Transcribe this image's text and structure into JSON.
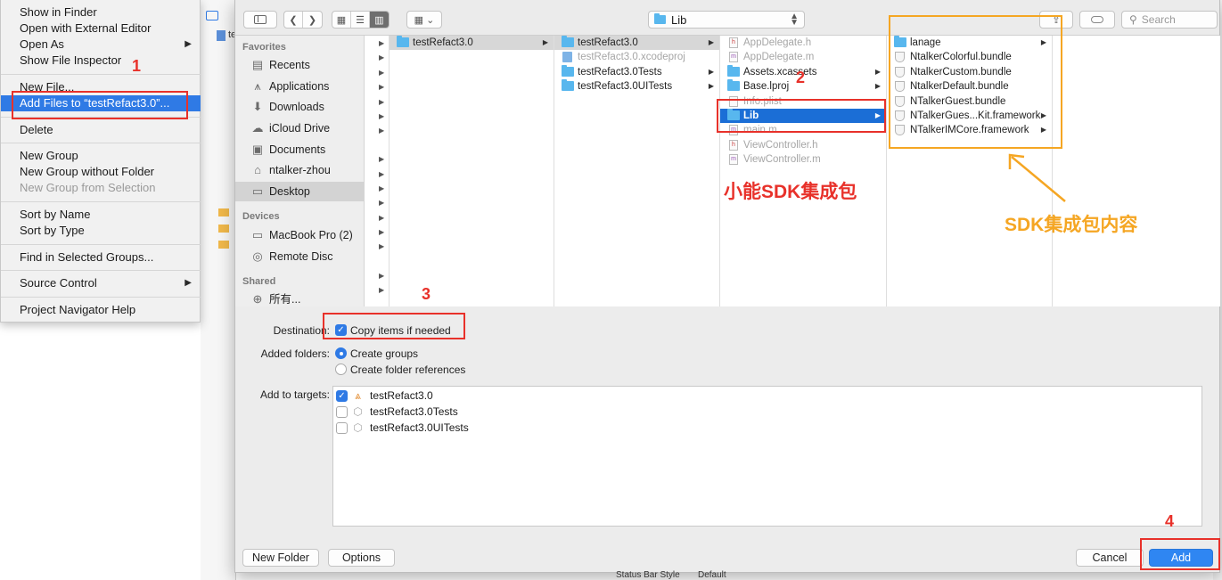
{
  "context_menu": {
    "items": [
      {
        "label": "Show in Finder"
      },
      {
        "label": "Open with External Editor"
      },
      {
        "label": "Open As"
      },
      {
        "label": "Show File Inspector"
      },
      {
        "label": "New File..."
      },
      {
        "label": "Add Files to “testRefact3.0”..."
      },
      {
        "label": "Delete"
      },
      {
        "label": "New Group"
      },
      {
        "label": "New Group without Folder"
      },
      {
        "label": "New Group from Selection"
      },
      {
        "label": "Sort by Name"
      },
      {
        "label": "Sort by Type"
      },
      {
        "label": "Find in Selected Groups..."
      },
      {
        "label": "Source Control"
      },
      {
        "label": "Project Navigator Help"
      }
    ]
  },
  "xcode": {
    "project_stub": "te",
    "status_bar_style_label": "Status Bar Style",
    "status_bar_style_value": "Default"
  },
  "dialog": {
    "location": "Lib",
    "search_placeholder": "Search",
    "sidebar": {
      "favorites_header": "Favorites",
      "favorites": [
        {
          "label": "Recents",
          "icon": "recents-icon"
        },
        {
          "label": "Applications",
          "icon": "applications-icon"
        },
        {
          "label": "Downloads",
          "icon": "downloads-icon"
        },
        {
          "label": "iCloud Drive",
          "icon": "cloud-icon"
        },
        {
          "label": "Documents",
          "icon": "documents-icon"
        },
        {
          "label": "ntalker-zhou",
          "icon": "home-icon"
        },
        {
          "label": "Desktop",
          "icon": "desktop-icon"
        }
      ],
      "devices_header": "Devices",
      "devices": [
        {
          "label": "MacBook Pro (2)",
          "icon": "laptop-icon"
        },
        {
          "label": "Remote Disc",
          "icon": "disc-icon"
        }
      ],
      "shared_header": "Shared",
      "shared": [
        {
          "label": "所有...",
          "icon": "network-icon"
        }
      ]
    },
    "columns": {
      "col1": [
        {
          "label": "testRefact3.0"
        }
      ],
      "col2": [
        {
          "label": "testRefact3.0"
        },
        {
          "label": "testRefact3.0.xcodeproj"
        },
        {
          "label": "testRefact3.0Tests"
        },
        {
          "label": "testRefact3.0UITests"
        }
      ],
      "col3": [
        {
          "label": "AppDelegate.h"
        },
        {
          "label": "AppDelegate.m"
        },
        {
          "label": "Assets.xcassets"
        },
        {
          "label": "Base.lproj"
        },
        {
          "label": "Info.plist"
        },
        {
          "label": "Lib"
        },
        {
          "label": "main.m"
        },
        {
          "label": "ViewController.h"
        },
        {
          "label": "ViewController.m"
        }
      ],
      "col4": [
        {
          "label": "lanage"
        },
        {
          "label": "NtalkerColorful.bundle"
        },
        {
          "label": "NtalkerCustom.bundle"
        },
        {
          "label": "NtalkerDefault.bundle"
        },
        {
          "label": "NTalkerGuest.bundle"
        },
        {
          "label": "NTalkerGues...Kit.framework"
        },
        {
          "label": "NTalkerIMCore.framework"
        }
      ]
    },
    "options": {
      "destination_label": "Destination:",
      "copy_items": "Copy items if needed",
      "added_folders_label": "Added folders:",
      "create_groups": "Create groups",
      "create_folder_refs": "Create folder references",
      "add_to_targets_label": "Add to targets:",
      "targets": [
        {
          "name": "testRefact3.0",
          "checked": true
        },
        {
          "name": "testRefact3.0Tests",
          "checked": false
        },
        {
          "name": "testRefact3.0UITests",
          "checked": false
        }
      ]
    },
    "buttons": {
      "new_folder": "New Folder",
      "options": "Options",
      "cancel": "Cancel",
      "add": "Add"
    }
  },
  "annotations": {
    "num1": "1",
    "num2": "2",
    "num3": "3",
    "num4": "4",
    "sdk_package": "小能SDK集成包",
    "sdk_contents": "SDK集成包内容",
    "red": "#e8312a",
    "orange": "#f5a623"
  }
}
